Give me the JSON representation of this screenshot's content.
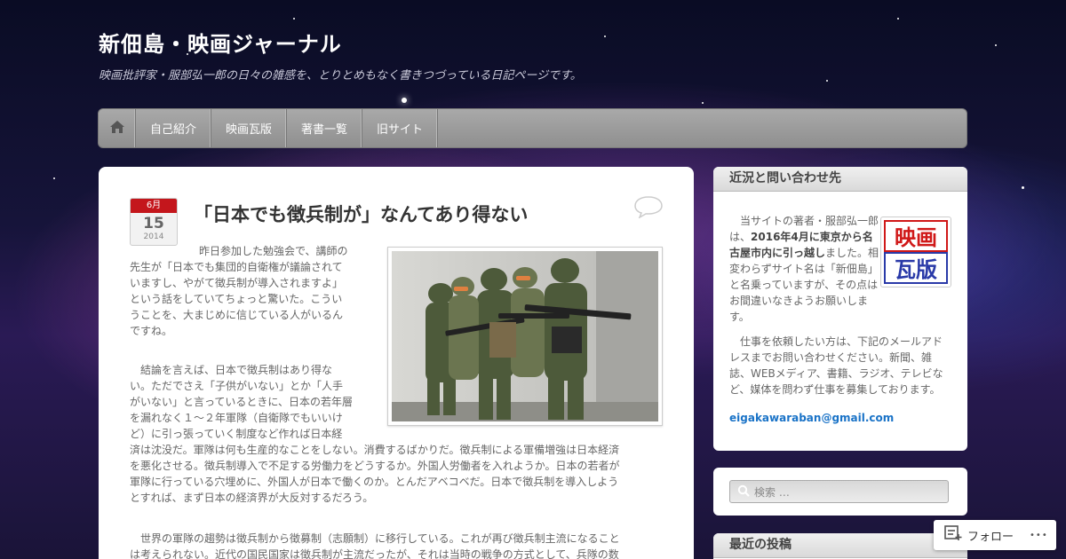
{
  "site": {
    "title": "新佃島・映画ジャーナル",
    "description": "映画批評家・服部弘一郎の日々の雑感を、とりとめもなく書きつづっている日記ページです。"
  },
  "nav": {
    "home_icon": "home-icon",
    "items": [
      "自己紹介",
      "映画瓦版",
      "著書一覧",
      "旧サイト"
    ]
  },
  "post": {
    "date": {
      "month": "6月",
      "day": "15",
      "year": "2014"
    },
    "title": "「日本でも徴兵制が」なんてあり得ない",
    "comment_icon": "comment-bubble-icon",
    "para1_lines": [
      "昨日参加した勉強会で、講師の",
      "先生が「日本でも集団的自衛権が議論されて",
      "いますし、やがて徴兵制が導入されますよ」",
      "という話をしていてちょっと驚いた。こうい",
      "うことを、大まじめに信じている人がいるん",
      "ですね。"
    ],
    "para2_lines_narrow": [
      "結論を言えば、日本で徴兵制はあり得な",
      "い。ただでさえ「子供がいない」とか「人手",
      "がいない」と言っているときに、日本の若年層",
      "を漏れなく１〜２年軍隊（自衛隊でもいいけ",
      "ど）に引っ張っていく制度など作れば日本経"
    ],
    "para2_lines_wide": [
      "済は沈没だ。軍隊は何も生産的なことをしない。消費するばかりだ。徴兵制による軍備増強は日本経済",
      "を悪化させる。徴兵制導入で不足する労働力をどうするか。外国人労働者を入れようか。日本の若者が",
      "軍隊に行っている穴埋めに、外国人が日本で働くのか。とんだアベコベだ。日本で徴兵制を導入しよう",
      "とすれば、まず日本の経済界が大反対するだろう。"
    ],
    "para3_lines": [
      "世界の軍隊の趨勢は徴兵制から徴募制（志願制）に移行している。これが再び徴兵制主流になること",
      "は考えられない。近代の国民国家は徴兵制が主流だったが、それは当時の戦争の方式として、兵隊の数"
    ]
  },
  "sidebar": {
    "contact": {
      "title": "近況と問い合わせ先",
      "text_a": "当サイトの著者・服部弘一郎は、",
      "text_bold": "2016年4月に東京から名古屋市内に引っ越し",
      "text_b": "ました。相変わらずサイト名は「新佃島」と名乗っていますが、その点はお間違いなきようお願いします。",
      "text2": "仕事を依頼したい方は、下記のメールアドレスまでお問い合わせください。新聞、雑誌、WEBメディア、書籍、ラジオ、テレビなど、媒体を問わず仕事を募集しております。",
      "email": "eigakawaraban@gmail.com",
      "logo_lines": [
        "映画",
        "瓦版"
      ]
    },
    "search": {
      "placeholder": "検索 …"
    },
    "recent": {
      "title": "最近の投稿"
    }
  },
  "follow": {
    "label": "フォロー",
    "more": "•••"
  }
}
